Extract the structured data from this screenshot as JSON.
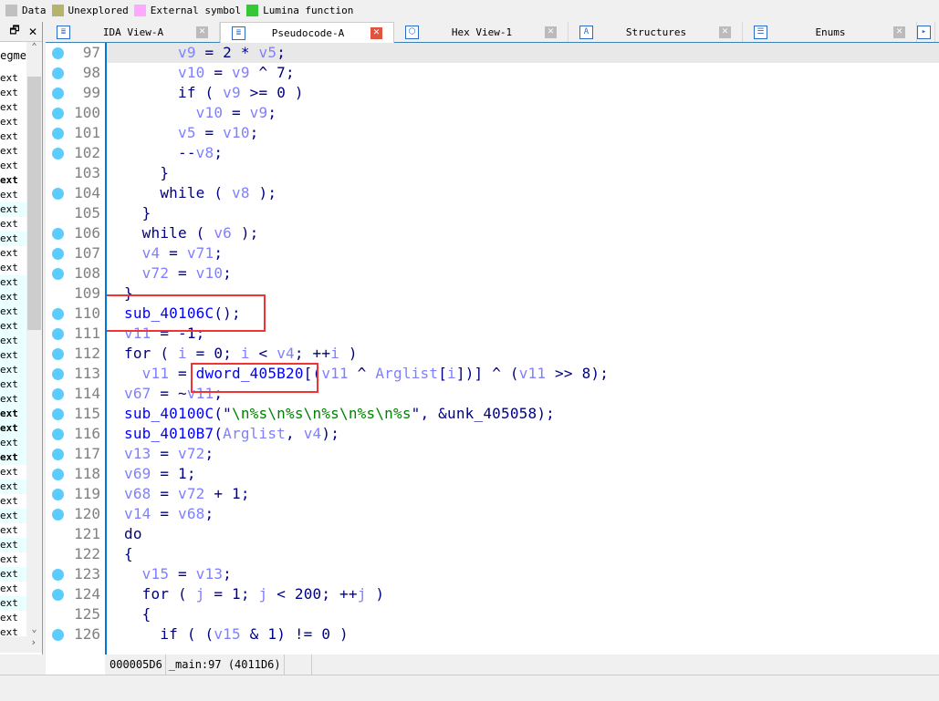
{
  "legend": [
    {
      "label": "Data",
      "color": "#c0c0c0"
    },
    {
      "label": "Unexplored",
      "color": "#b4b46c"
    },
    {
      "label": "External symbol",
      "color": "#ffa8ff"
    },
    {
      "label": "Lumina function",
      "color": "#34c934"
    }
  ],
  "left_panel": {
    "restore_icon": "restore-icon",
    "close_label": "✕",
    "header": "Segme",
    "items": [
      {
        "t": "ext"
      },
      {
        "t": "ext"
      },
      {
        "t": "ext"
      },
      {
        "t": "ext"
      },
      {
        "t": "ext"
      },
      {
        "t": "ext"
      },
      {
        "t": "ext"
      },
      {
        "t": "ext",
        "b": 1
      },
      {
        "t": "ext"
      },
      {
        "t": "ext",
        "c": 1
      },
      {
        "t": "ext"
      },
      {
        "t": "ext",
        "c": 1
      },
      {
        "t": "ext"
      },
      {
        "t": "ext"
      },
      {
        "t": "ext",
        "c": 1
      },
      {
        "t": "ext",
        "c": 1
      },
      {
        "t": "ext",
        "c": 1
      },
      {
        "t": "ext",
        "c": 1
      },
      {
        "t": "ext",
        "c": 1
      },
      {
        "t": "ext",
        "c": 1
      },
      {
        "t": "ext",
        "c": 1
      },
      {
        "t": "ext",
        "c": 1
      },
      {
        "t": "ext",
        "c": 1
      },
      {
        "t": "ext",
        "b": 1,
        "c": 1
      },
      {
        "t": "ext",
        "b": 1,
        "c": 1
      },
      {
        "t": "ext",
        "c": 1
      },
      {
        "t": "ext",
        "b": 1,
        "c": 1
      },
      {
        "t": "ext"
      },
      {
        "t": "ext",
        "c": 1
      },
      {
        "t": "ext"
      },
      {
        "t": "ext",
        "c": 1
      },
      {
        "t": "ext"
      },
      {
        "t": "ext",
        "c": 1
      },
      {
        "t": "ext"
      },
      {
        "t": "ext",
        "c": 1
      },
      {
        "t": "ext"
      },
      {
        "t": "ext",
        "c": 1
      },
      {
        "t": "ext"
      },
      {
        "t": "ext"
      }
    ]
  },
  "tabs": [
    {
      "label": "IDA View-A",
      "icon": "ida-view-icon",
      "glyph": "≣",
      "active": false
    },
    {
      "label": "Pseudocode-A",
      "icon": "pseudocode-icon",
      "glyph": "≣",
      "active": true
    },
    {
      "label": "Hex View-1",
      "icon": "hex-view-icon",
      "glyph": "⬡",
      "active": false
    },
    {
      "label": "Structures",
      "icon": "structures-icon",
      "glyph": "A",
      "active": false
    },
    {
      "label": "Enums",
      "icon": "enums-icon",
      "glyph": "☰",
      "active": false
    }
  ],
  "code": {
    "lines": [
      {
        "n": "97",
        "dot": 1,
        "hl": 1,
        "t": [
          [
            "",
            "      "
          ],
          [
            "v",
            "v9"
          ],
          [
            "k",
            " = "
          ],
          [
            "n",
            "2"
          ],
          [
            "k",
            " * "
          ],
          [
            "v",
            "v5"
          ],
          [
            "k",
            ";"
          ]
        ]
      },
      {
        "n": "98",
        "dot": 1,
        "t": [
          [
            "",
            "      "
          ],
          [
            "v",
            "v10"
          ],
          [
            "k",
            " = "
          ],
          [
            "v",
            "v9"
          ],
          [
            "k",
            " ^ "
          ],
          [
            "n",
            "7"
          ],
          [
            "k",
            ";"
          ]
        ]
      },
      {
        "n": "99",
        "dot": 1,
        "t": [
          [
            "",
            "      "
          ],
          [
            "k",
            "if ( "
          ],
          [
            "v",
            "v9"
          ],
          [
            "k",
            " >= "
          ],
          [
            "n",
            "0"
          ],
          [
            "k",
            " )"
          ]
        ]
      },
      {
        "n": "100",
        "dot": 1,
        "t": [
          [
            "",
            "        "
          ],
          [
            "v",
            "v10"
          ],
          [
            "k",
            " = "
          ],
          [
            "v",
            "v9"
          ],
          [
            "k",
            ";"
          ]
        ]
      },
      {
        "n": "101",
        "dot": 1,
        "t": [
          [
            "",
            "      "
          ],
          [
            "v",
            "v5"
          ],
          [
            "k",
            " = "
          ],
          [
            "v",
            "v10"
          ],
          [
            "k",
            ";"
          ]
        ]
      },
      {
        "n": "102",
        "dot": 1,
        "t": [
          [
            "",
            "      "
          ],
          [
            "k",
            "--"
          ],
          [
            "v",
            "v8"
          ],
          [
            "k",
            ";"
          ]
        ]
      },
      {
        "n": "103",
        "t": [
          [
            "",
            "    "
          ],
          [
            "k",
            "}"
          ]
        ]
      },
      {
        "n": "104",
        "dot": 1,
        "t": [
          [
            "",
            "    "
          ],
          [
            "k",
            "while ( "
          ],
          [
            "v",
            "v8"
          ],
          [
            "k",
            " );"
          ]
        ]
      },
      {
        "n": "105",
        "t": [
          [
            "",
            "  "
          ],
          [
            "k",
            "}"
          ]
        ]
      },
      {
        "n": "106",
        "dot": 1,
        "t": [
          [
            "",
            "  "
          ],
          [
            "k",
            "while ( "
          ],
          [
            "v",
            "v6"
          ],
          [
            "k",
            " );"
          ]
        ]
      },
      {
        "n": "107",
        "dot": 1,
        "t": [
          [
            "",
            "  "
          ],
          [
            "v",
            "v4"
          ],
          [
            "k",
            " = "
          ],
          [
            "v",
            "v71"
          ],
          [
            "k",
            ";"
          ]
        ]
      },
      {
        "n": "108",
        "dot": 1,
        "t": [
          [
            "",
            "  "
          ],
          [
            "v",
            "v72"
          ],
          [
            "k",
            " = "
          ],
          [
            "v",
            "v10"
          ],
          [
            "k",
            ";"
          ]
        ]
      },
      {
        "n": "109",
        "t": [
          [
            "k",
            "}"
          ]
        ]
      },
      {
        "n": "110",
        "dot": 1,
        "t": [
          [
            "f",
            "sub_40106C"
          ],
          [
            "k",
            "();"
          ]
        ]
      },
      {
        "n": "111",
        "dot": 1,
        "t": [
          [
            "v",
            "v11"
          ],
          [
            "k",
            " = "
          ],
          [
            "n",
            "-1"
          ],
          [
            "k",
            ";"
          ]
        ]
      },
      {
        "n": "112",
        "dot": 1,
        "t": [
          [
            "k",
            "for ( "
          ],
          [
            "v",
            "i"
          ],
          [
            "k",
            " = "
          ],
          [
            "n",
            "0"
          ],
          [
            "k",
            "; "
          ],
          [
            "v",
            "i"
          ],
          [
            "k",
            " < "
          ],
          [
            "v",
            "v4"
          ],
          [
            "k",
            "; ++"
          ],
          [
            "v",
            "i"
          ],
          [
            "k",
            " )"
          ]
        ]
      },
      {
        "n": "113",
        "dot": 1,
        "t": [
          [
            "",
            "  "
          ],
          [
            "v",
            "v11"
          ],
          [
            "k",
            " = "
          ],
          [
            "f",
            "dword_405B20"
          ],
          [
            "k",
            "[("
          ],
          [
            "v",
            "v11"
          ],
          [
            "k",
            " ^ "
          ],
          [
            "v",
            "Arglist"
          ],
          [
            "k",
            "["
          ],
          [
            "v",
            "i"
          ],
          [
            "k",
            "])] ^ ("
          ],
          [
            "v",
            "v11"
          ],
          [
            "k",
            " >> "
          ],
          [
            "n",
            "8"
          ],
          [
            "k",
            ");"
          ]
        ]
      },
      {
        "n": "114",
        "dot": 1,
        "t": [
          [
            "v",
            "v67"
          ],
          [
            "k",
            " = ~"
          ],
          [
            "v",
            "v11"
          ],
          [
            "k",
            ";"
          ]
        ]
      },
      {
        "n": "115",
        "dot": 1,
        "t": [
          [
            "f",
            "sub_40100C"
          ],
          [
            "k",
            "(\""
          ],
          [
            "s",
            "\\n%s\\n%s\\n%s\\n%s\\n%s"
          ],
          [
            "k",
            "\", &unk_405058);"
          ]
        ]
      },
      {
        "n": "116",
        "dot": 1,
        "t": [
          [
            "f",
            "sub_4010B7"
          ],
          [
            "k",
            "("
          ],
          [
            "v",
            "Arglist"
          ],
          [
            "k",
            ", "
          ],
          [
            "v",
            "v4"
          ],
          [
            "k",
            ");"
          ]
        ]
      },
      {
        "n": "117",
        "dot": 1,
        "t": [
          [
            "v",
            "v13"
          ],
          [
            "k",
            " = "
          ],
          [
            "v",
            "v72"
          ],
          [
            "k",
            ";"
          ]
        ]
      },
      {
        "n": "118",
        "dot": 1,
        "t": [
          [
            "v",
            "v69"
          ],
          [
            "k",
            " = "
          ],
          [
            "n",
            "1"
          ],
          [
            "k",
            ";"
          ]
        ]
      },
      {
        "n": "119",
        "dot": 1,
        "t": [
          [
            "v",
            "v68"
          ],
          [
            "k",
            " = "
          ],
          [
            "v",
            "v72"
          ],
          [
            "k",
            " + "
          ],
          [
            "n",
            "1"
          ],
          [
            "k",
            ";"
          ]
        ]
      },
      {
        "n": "120",
        "dot": 1,
        "t": [
          [
            "v",
            "v14"
          ],
          [
            "k",
            " = "
          ],
          [
            "v",
            "v68"
          ],
          [
            "k",
            ";"
          ]
        ]
      },
      {
        "n": "121",
        "t": [
          [
            "k",
            "do"
          ]
        ]
      },
      {
        "n": "122",
        "t": [
          [
            "k",
            "{"
          ]
        ]
      },
      {
        "n": "123",
        "dot": 1,
        "t": [
          [
            "",
            "  "
          ],
          [
            "v",
            "v15"
          ],
          [
            "k",
            " = "
          ],
          [
            "v",
            "v13"
          ],
          [
            "k",
            ";"
          ]
        ]
      },
      {
        "n": "124",
        "dot": 1,
        "t": [
          [
            "",
            "  "
          ],
          [
            "k",
            "for ( "
          ],
          [
            "v",
            "j"
          ],
          [
            "k",
            " = "
          ],
          [
            "n",
            "1"
          ],
          [
            "k",
            "; "
          ],
          [
            "v",
            "j"
          ],
          [
            "k",
            " < "
          ],
          [
            "n",
            "200"
          ],
          [
            "k",
            "; ++"
          ],
          [
            "v",
            "j"
          ],
          [
            "k",
            " )"
          ]
        ]
      },
      {
        "n": "125",
        "t": [
          [
            "",
            "  "
          ],
          [
            "k",
            "{"
          ]
        ]
      },
      {
        "n": "126",
        "dot": 1,
        "t": [
          [
            "",
            "    "
          ],
          [
            "k",
            "if ( ("
          ],
          [
            "v",
            "v15"
          ],
          [
            "k",
            " & "
          ],
          [
            "n",
            "1"
          ],
          [
            "k",
            ") != "
          ],
          [
            "n",
            "0"
          ],
          [
            "k",
            " )"
          ]
        ]
      }
    ]
  },
  "status": {
    "offset": "000005D6",
    "location": "_main:97 (4011D6)"
  }
}
